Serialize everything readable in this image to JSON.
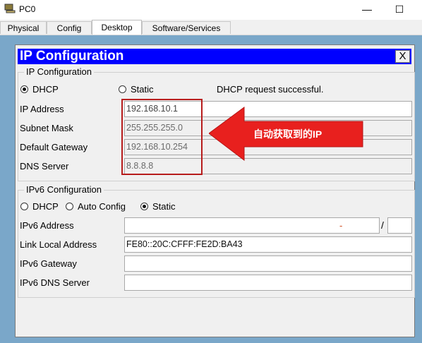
{
  "window": {
    "title": "PC0",
    "minimize": "—",
    "maximize": "☐"
  },
  "tabs": [
    {
      "label": "Physical"
    },
    {
      "label": "Config"
    },
    {
      "label": "Desktop"
    },
    {
      "label": "Software/Services"
    }
  ],
  "dialog": {
    "title": "IP Configuration",
    "close": "X"
  },
  "ipv4": {
    "legend": "IP Configuration",
    "dhcp_label": "DHCP",
    "static_label": "Static",
    "status": "DHCP request successful.",
    "mode_selected": "DHCP",
    "fields": [
      {
        "label": "IP Address",
        "value": "192.168.10.1"
      },
      {
        "label": "Subnet Mask",
        "value": "255.255.255.0"
      },
      {
        "label": "Default Gateway",
        "value": "192.168.10.254"
      },
      {
        "label": "DNS Server",
        "value": "8.8.8.8"
      }
    ]
  },
  "ipv6": {
    "legend": "IPv6 Configuration",
    "dhcp_label": "DHCP",
    "auto_label": "Auto Config",
    "static_label": "Static",
    "mode_selected": "Static",
    "address_label": "IPv6 Address",
    "address_value": "",
    "prefix_value": "",
    "slash": "/",
    "link_local_label": "Link Local Address",
    "link_local_value": "FE80::20C:CFFF:FE2D:BA43",
    "gateway_label": "IPv6 Gateway",
    "gateway_value": "",
    "dns_label": "IPv6 DNS Server",
    "dns_value": ""
  },
  "annotation": {
    "text": "自动获取到的IP",
    "color": "#e8201e"
  },
  "colors": {
    "dialog_title_bg": "#0000ff",
    "desktop_bg": "#7aa7c9"
  }
}
